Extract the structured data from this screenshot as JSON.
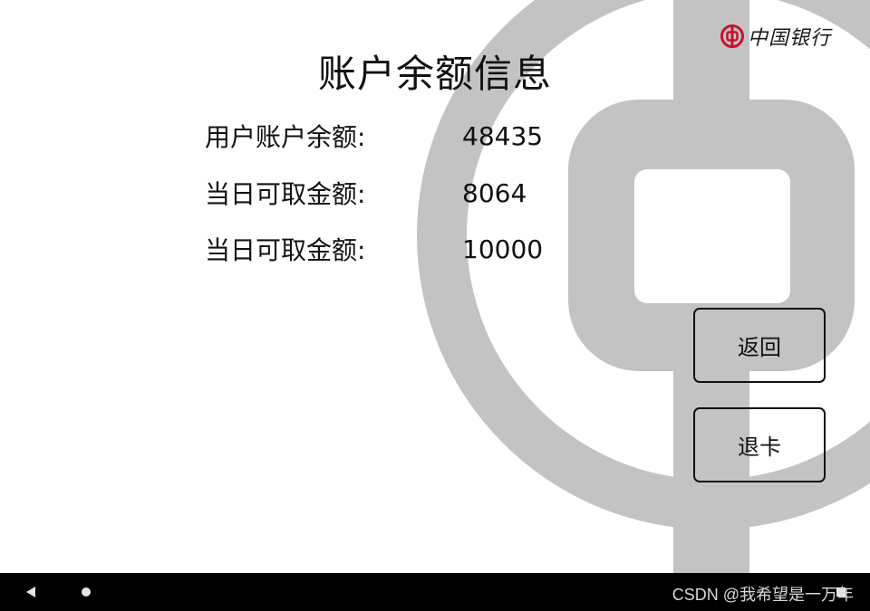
{
  "header": {
    "brand_name": "中国银行",
    "title": "账户余额信息"
  },
  "info": {
    "rows": [
      {
        "label": "用户账户余额:",
        "value": "48435"
      },
      {
        "label": "当日可取金额:",
        "value": "8064"
      },
      {
        "label": "当日可取金额:",
        "value": "10000"
      }
    ]
  },
  "actions": {
    "back_label": "返回",
    "eject_label": "退卡"
  },
  "watermark": "CSDN @我希望是一万年",
  "colors": {
    "logo_gray": "#c3c3c3",
    "brand_red": "#c8102e",
    "navbar": "#000000"
  },
  "icons": {
    "nav_back": "back-triangle-icon",
    "nav_home": "home-dot-icon",
    "nav_recent": "recent-square-icon",
    "brand": "bank-of-china-logo-icon"
  }
}
